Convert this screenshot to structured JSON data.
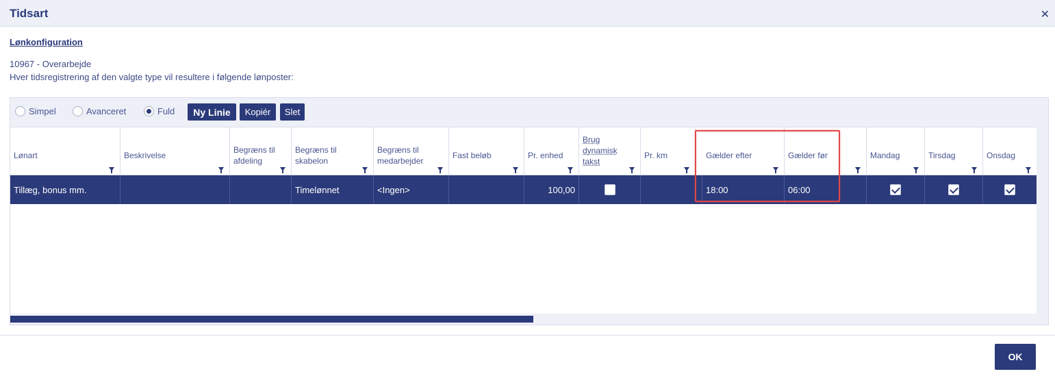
{
  "dialog": {
    "title": "Tidsart",
    "close_icon": "close-icon"
  },
  "section": {
    "link": "Lønkonfiguration",
    "line1": "10967 - Overarbejde",
    "line2": "Hver tidsregistrering af den valgte type vil resultere i følgende lønposter:"
  },
  "toolbar": {
    "radios": [
      {
        "label": "Simpel",
        "selected": false
      },
      {
        "label": "Avanceret",
        "selected": false
      },
      {
        "label": "Fuld",
        "selected": true
      }
    ],
    "buttons": {
      "new_line": "Ny Linie",
      "copy": "Kopiér",
      "delete": "Slet"
    }
  },
  "table": {
    "columns": [
      "Lønart",
      "Beskrivelse",
      "Begræns til afdeling",
      "Begræns til skabelon",
      "Begræns til medarbejder",
      "Fast beløb",
      "Pr. enhed",
      "Brug dynamisk takst",
      "Pr. km",
      "Gælder efter",
      "Gælder før",
      "",
      "Mandag",
      "Tirsdag",
      "Onsdag"
    ],
    "rows": [
      {
        "lonart": "Tillæg, bonus mm.",
        "beskrivelse": "",
        "afdeling": "",
        "skabelon": "Timelønnet",
        "medarbejder": "<Ingen>",
        "fast_belob": "",
        "pr_enhed": "100,00",
        "dynamisk_takst": false,
        "pr_km": "",
        "gaelder_efter": "18:00",
        "gaelder_for": "06:00",
        "mandag": true,
        "tirsdag": true,
        "onsdag": true
      }
    ]
  },
  "scrollbar": {
    "thumb_fraction": 0.51
  },
  "highlight_color": "#e04848",
  "accent_color": "#2b3a7a",
  "footer": {
    "ok": "OK"
  }
}
